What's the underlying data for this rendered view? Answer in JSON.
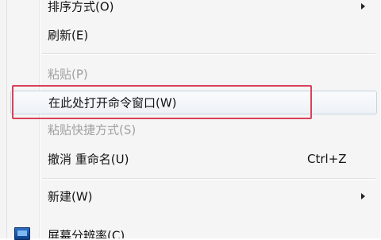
{
  "menu": {
    "items": [
      {
        "label": "排序方式(O)",
        "shortcut": "",
        "has_submenu": true,
        "disabled": false
      },
      {
        "label": "刷新(E)",
        "shortcut": "",
        "has_submenu": false,
        "disabled": false
      },
      {
        "label": "粘贴(P)",
        "shortcut": "",
        "has_submenu": false,
        "disabled": true
      },
      {
        "label": "在此处打开命令窗口(W)",
        "shortcut": "",
        "has_submenu": false,
        "disabled": false,
        "highlighted": true
      },
      {
        "label": "粘贴快捷方式(S)",
        "shortcut": "",
        "has_submenu": false,
        "disabled": true
      },
      {
        "label": "撤消 重命名(U)",
        "shortcut": "Ctrl+Z",
        "has_submenu": false,
        "disabled": false
      },
      {
        "label": "新建(W)",
        "shortcut": "",
        "has_submenu": true,
        "disabled": false
      },
      {
        "label": "屏幕分辨率(C)",
        "shortcut": "",
        "has_submenu": false,
        "disabled": false,
        "icon": "screen-resolution-icon"
      }
    ]
  },
  "colors": {
    "menu_background": "#f5f5f5",
    "text": "#141414",
    "disabled_text": "#a0a0a0",
    "annotation_box": "#d9415a",
    "hover_border": "#c9d3de"
  }
}
